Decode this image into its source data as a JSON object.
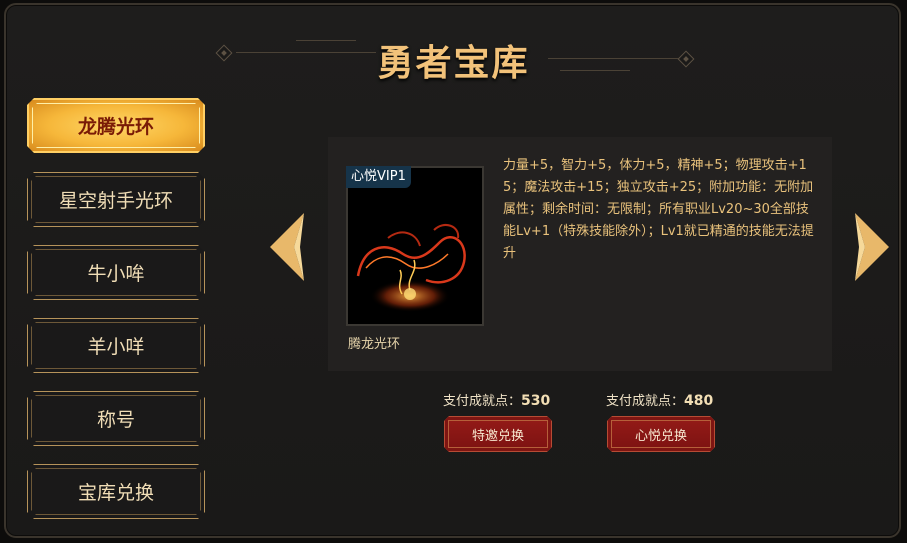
{
  "title": "勇者宝库",
  "sidebar": {
    "items": [
      {
        "label": "龙腾光环",
        "active": true
      },
      {
        "label": "星空射手光环",
        "active": false
      },
      {
        "label": "牛小哞",
        "active": false
      },
      {
        "label": "羊小咩",
        "active": false
      },
      {
        "label": "称号",
        "active": false
      },
      {
        "label": "宝库兑换",
        "active": false
      }
    ]
  },
  "item": {
    "badge": "心悦VIP1",
    "name": "腾龙光环",
    "description": "力量+5，智力+5，体力+5，精神+5；物理攻击+15；魔法攻击+15；独立攻击+25；附加功能：无附加属性；剩余时间：无限制；所有职业Lv20~30全部技能Lv+1（特殊技能除外）；Lv1就已精通的技能无法提升"
  },
  "navigation": {
    "prev_icon": "chevron-left-icon",
    "next_icon": "chevron-right-icon"
  },
  "exchange": {
    "options": [
      {
        "cost_label": "支付成就点：",
        "cost_value": "530",
        "button_label": "特邀兑换"
      },
      {
        "cost_label": "支付成就点：",
        "cost_value": "480",
        "button_label": "心悦兑换"
      }
    ]
  },
  "colors": {
    "accent_gold": "#f2c27a",
    "button_red": "#8c1715",
    "background": "#1d1c1b"
  }
}
